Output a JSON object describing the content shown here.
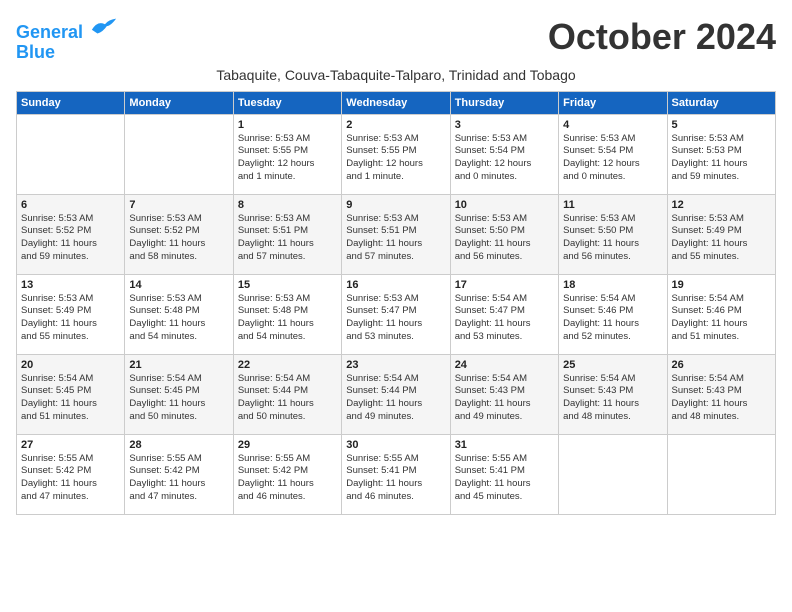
{
  "logo": {
    "line1": "General",
    "line2": "Blue",
    "bird_color": "#2196F3"
  },
  "title": "October 2024",
  "subtitle": "Tabaquite, Couva-Tabaquite-Talparo, Trinidad and Tobago",
  "weekdays": [
    "Sunday",
    "Monday",
    "Tuesday",
    "Wednesday",
    "Thursday",
    "Friday",
    "Saturday"
  ],
  "weeks": [
    [
      {
        "day": "",
        "info": ""
      },
      {
        "day": "",
        "info": ""
      },
      {
        "day": "1",
        "info": "Sunrise: 5:53 AM\nSunset: 5:55 PM\nDaylight: 12 hours\nand 1 minute."
      },
      {
        "day": "2",
        "info": "Sunrise: 5:53 AM\nSunset: 5:55 PM\nDaylight: 12 hours\nand 1 minute."
      },
      {
        "day": "3",
        "info": "Sunrise: 5:53 AM\nSunset: 5:54 PM\nDaylight: 12 hours\nand 0 minutes."
      },
      {
        "day": "4",
        "info": "Sunrise: 5:53 AM\nSunset: 5:54 PM\nDaylight: 12 hours\nand 0 minutes."
      },
      {
        "day": "5",
        "info": "Sunrise: 5:53 AM\nSunset: 5:53 PM\nDaylight: 11 hours\nand 59 minutes."
      }
    ],
    [
      {
        "day": "6",
        "info": "Sunrise: 5:53 AM\nSunset: 5:52 PM\nDaylight: 11 hours\nand 59 minutes."
      },
      {
        "day": "7",
        "info": "Sunrise: 5:53 AM\nSunset: 5:52 PM\nDaylight: 11 hours\nand 58 minutes."
      },
      {
        "day": "8",
        "info": "Sunrise: 5:53 AM\nSunset: 5:51 PM\nDaylight: 11 hours\nand 57 minutes."
      },
      {
        "day": "9",
        "info": "Sunrise: 5:53 AM\nSunset: 5:51 PM\nDaylight: 11 hours\nand 57 minutes."
      },
      {
        "day": "10",
        "info": "Sunrise: 5:53 AM\nSunset: 5:50 PM\nDaylight: 11 hours\nand 56 minutes."
      },
      {
        "day": "11",
        "info": "Sunrise: 5:53 AM\nSunset: 5:50 PM\nDaylight: 11 hours\nand 56 minutes."
      },
      {
        "day": "12",
        "info": "Sunrise: 5:53 AM\nSunset: 5:49 PM\nDaylight: 11 hours\nand 55 minutes."
      }
    ],
    [
      {
        "day": "13",
        "info": "Sunrise: 5:53 AM\nSunset: 5:49 PM\nDaylight: 11 hours\nand 55 minutes."
      },
      {
        "day": "14",
        "info": "Sunrise: 5:53 AM\nSunset: 5:48 PM\nDaylight: 11 hours\nand 54 minutes."
      },
      {
        "day": "15",
        "info": "Sunrise: 5:53 AM\nSunset: 5:48 PM\nDaylight: 11 hours\nand 54 minutes."
      },
      {
        "day": "16",
        "info": "Sunrise: 5:53 AM\nSunset: 5:47 PM\nDaylight: 11 hours\nand 53 minutes."
      },
      {
        "day": "17",
        "info": "Sunrise: 5:54 AM\nSunset: 5:47 PM\nDaylight: 11 hours\nand 53 minutes."
      },
      {
        "day": "18",
        "info": "Sunrise: 5:54 AM\nSunset: 5:46 PM\nDaylight: 11 hours\nand 52 minutes."
      },
      {
        "day": "19",
        "info": "Sunrise: 5:54 AM\nSunset: 5:46 PM\nDaylight: 11 hours\nand 51 minutes."
      }
    ],
    [
      {
        "day": "20",
        "info": "Sunrise: 5:54 AM\nSunset: 5:45 PM\nDaylight: 11 hours\nand 51 minutes."
      },
      {
        "day": "21",
        "info": "Sunrise: 5:54 AM\nSunset: 5:45 PM\nDaylight: 11 hours\nand 50 minutes."
      },
      {
        "day": "22",
        "info": "Sunrise: 5:54 AM\nSunset: 5:44 PM\nDaylight: 11 hours\nand 50 minutes."
      },
      {
        "day": "23",
        "info": "Sunrise: 5:54 AM\nSunset: 5:44 PM\nDaylight: 11 hours\nand 49 minutes."
      },
      {
        "day": "24",
        "info": "Sunrise: 5:54 AM\nSunset: 5:43 PM\nDaylight: 11 hours\nand 49 minutes."
      },
      {
        "day": "25",
        "info": "Sunrise: 5:54 AM\nSunset: 5:43 PM\nDaylight: 11 hours\nand 48 minutes."
      },
      {
        "day": "26",
        "info": "Sunrise: 5:54 AM\nSunset: 5:43 PM\nDaylight: 11 hours\nand 48 minutes."
      }
    ],
    [
      {
        "day": "27",
        "info": "Sunrise: 5:55 AM\nSunset: 5:42 PM\nDaylight: 11 hours\nand 47 minutes."
      },
      {
        "day": "28",
        "info": "Sunrise: 5:55 AM\nSunset: 5:42 PM\nDaylight: 11 hours\nand 47 minutes."
      },
      {
        "day": "29",
        "info": "Sunrise: 5:55 AM\nSunset: 5:42 PM\nDaylight: 11 hours\nand 46 minutes."
      },
      {
        "day": "30",
        "info": "Sunrise: 5:55 AM\nSunset: 5:41 PM\nDaylight: 11 hours\nand 46 minutes."
      },
      {
        "day": "31",
        "info": "Sunrise: 5:55 AM\nSunset: 5:41 PM\nDaylight: 11 hours\nand 45 minutes."
      },
      {
        "day": "",
        "info": ""
      },
      {
        "day": "",
        "info": ""
      }
    ]
  ]
}
